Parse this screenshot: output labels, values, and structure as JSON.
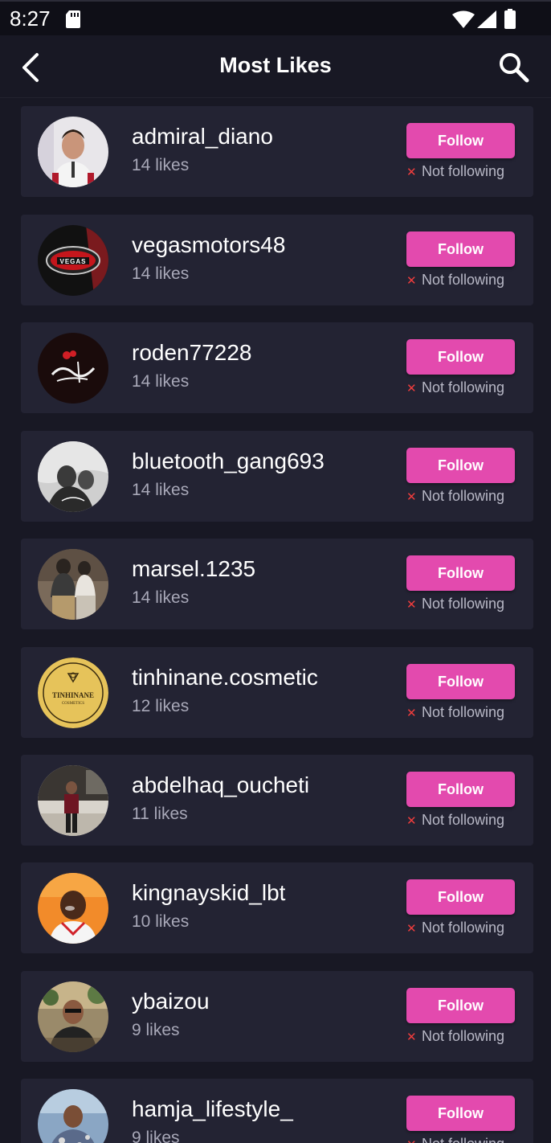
{
  "status_bar": {
    "time": "8:27",
    "icons": [
      "sd-card-icon",
      "wifi-icon",
      "cell-signal-icon",
      "battery-icon"
    ]
  },
  "app_bar": {
    "title": "Most Likes",
    "back_icon": "chevron-left-icon",
    "search_icon": "search-icon"
  },
  "theme": {
    "background": "#181824",
    "card": "#232333",
    "accent": "#e34aae",
    "status_x": "#ef3d3d"
  },
  "users": [
    {
      "username": "admiral_diano",
      "likes": "14 likes",
      "follow_label": "Follow",
      "status": "Not following"
    },
    {
      "username": "vegasmotors48",
      "likes": "14 likes",
      "follow_label": "Follow",
      "status": "Not following"
    },
    {
      "username": "roden77228",
      "likes": "14 likes",
      "follow_label": "Follow",
      "status": "Not following"
    },
    {
      "username": "bluetooth_gang693",
      "likes": "14 likes",
      "follow_label": "Follow",
      "status": "Not following"
    },
    {
      "username": "marsel.1235",
      "likes": "14 likes",
      "follow_label": "Follow",
      "status": "Not following"
    },
    {
      "username": "tinhinane.cosmetic",
      "likes": "12 likes",
      "follow_label": "Follow",
      "status": "Not following"
    },
    {
      "username": "abdelhaq_oucheti",
      "likes": "11 likes",
      "follow_label": "Follow",
      "status": "Not following"
    },
    {
      "username": "kingnayskid_lbt",
      "likes": "10 likes",
      "follow_label": "Follow",
      "status": "Not following"
    },
    {
      "username": "ybaizou",
      "likes": "9 likes",
      "follow_label": "Follow",
      "status": "Not following"
    },
    {
      "username": "hamja_lifestyle_",
      "likes": "9 likes",
      "follow_label": "Follow",
      "status": "Not following"
    }
  ]
}
